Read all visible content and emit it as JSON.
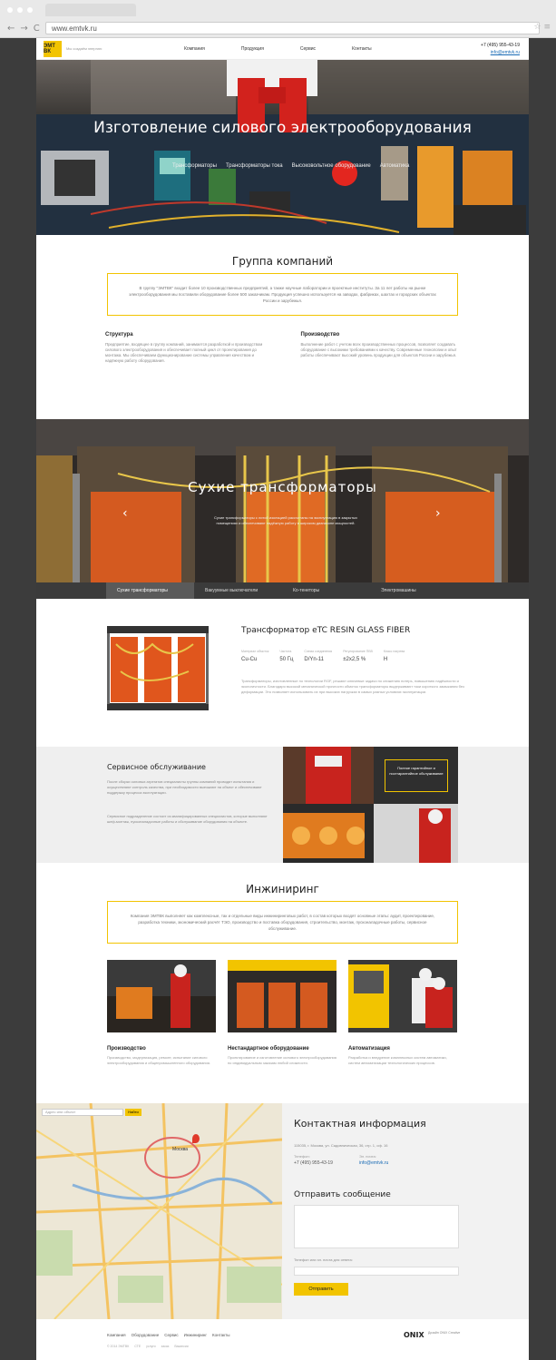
{
  "browser": {
    "url": "www.emtvk.ru",
    "back": "←",
    "forward": "→",
    "reload": "C",
    "star": "☆ ≡"
  },
  "header": {
    "logo": "ЭМТ ВК",
    "tagline": "Мы создаём энергию",
    "nav": [
      "Компания",
      "Продукция",
      "Сервис",
      "Контакты"
    ],
    "phone": "+7 (495) 955-43-19",
    "email": "info@emtvk.ru"
  },
  "hero": {
    "title": "Изготовление силового электрооборудования",
    "links": [
      "Трансформаторы",
      "Трансформаторы тока",
      "Высоковольтное оборудование",
      "Автоматика"
    ]
  },
  "group": {
    "title": "Группа компаний",
    "intro": "В группу \"ЭМТВК\" входит более 10 производственных предприятий, а также научные лаборатории и проектные институты. За 11 лет работы на рынке электрооборудования мы поставили оборудование более 500 заказчикам. Продукция успешно используется на заводах, фабриках, шахтах и городских объектах России и зарубежья.",
    "cols": [
      {
        "title": "Структура",
        "text": "Предприятие, входящее в группу компаний, занимается разработкой и производством силового электрооборудования и обеспечивает полный цикл от проектирования до монтажа. Мы обеспечиваем функционирование системы управления качеством и надёжную работу оборудования."
      },
      {
        "title": "Производство",
        "text": "Выполнение работ с учетом всех производственных процессов, позволяет создавать оборудование с высокими требованиями к качеству. Современные технологии и опыт работы обеспечивают высокий уровень продукции для объектов России и зарубежья."
      }
    ]
  },
  "transformers": {
    "title": "Сухие трансформаторы",
    "desc": "Сухие трансформаторы с литой изоляцией рассчитаны на эксплуатацию в закрытых помещениях и обеспечивают надёжную работу в широком диапазоне мощностей.",
    "prev": "‹",
    "next": "›",
    "tabs": [
      "Сухие трансформаторы",
      "Вакуумные выключатели",
      "Ко-тенеторы",
      "Электромашины"
    ]
  },
  "product": {
    "title": "Трансформатор eTC RESIN GLASS FIBER",
    "specs": [
      {
        "k": "Материал обмоток",
        "v": "Cu-Cu"
      },
      {
        "k": "Частота",
        "v": "50 Гц"
      },
      {
        "k": "Схема соединения",
        "v": "D/Yn-11"
      },
      {
        "k": "Регулирование ПБВ",
        "v": "±2х2,5 %"
      },
      {
        "k": "Класс нагрева",
        "v": "H"
      }
    ],
    "desc": "Трансформаторы, изготовленные по технологии RGF, решают ключевые задачи по снижению потерь, повышению надёжности и экологичности. Благодаря высокой механической прочности обмоток трансформаторы выдерживают токи короткого замыкания без деформации. Это позволяет использовать их при высоких нагрузках в самых разных условиях эксплуатации."
  },
  "service": {
    "title": "Сервисное обслуживание",
    "p1": "После сборки силовых агрегатов специалисты группы компаний проводят испытания и осуществляют контроль качества, при необходимости выезжают на объект и обеспечивают поддержку процесса эксплуатации.",
    "p2": "Сервисное подразделение состоит из квалифицированных специалистов, которые выполняют шеф-монтаж, пусконаладочные работы и обслуживание оборудования на объекте.",
    "box": "Полное гарантийное и постгарантийное обслуживание"
  },
  "engineering": {
    "title": "Инжиниринг",
    "intro": "Компания ЭМТВК выполняет как комплексные, так и отдельные виды инжиниринговых работ, в состав которых входят основные этапы: аудит, проектирование, разработка техники, экономический расчёт ТЭО, производство и поставка оборудования, строительство, монтаж, пусконаладочные работы, сервисное обслуживание.",
    "cards": [
      {
        "title": "Производство",
        "text": "Производство, модернизация, ремонт, испытание силового электрооборудования и общепромышленного оборудования."
      },
      {
        "title": "Нестандартное оборудование",
        "text": "Проектирование и изготовление силового электрооборудования по индивидуальным заказам любой сложности."
      },
      {
        "title": "Автоматизация",
        "text": "Разработка и внедрение комплексных систем автоматики, систем автоматизации технологических процессов."
      }
    ]
  },
  "contact": {
    "title": "Контактная информация",
    "address": "115035, г. Москва, ул. Садовническая, 36, стр. 1, оф. 16",
    "phone_label": "Телефон:",
    "phone": "+7 (495) 955-43-19",
    "email_label": "Эл. почта:",
    "email": "info@emtvk.ru",
    "form_title": "Отправить сообщение",
    "form_label": "Телефон или эл. почта для ответа:",
    "send": "Отправить",
    "map_city": "Москва",
    "map_search": "Найти",
    "map_search_placeholder": "Адрес или объект"
  },
  "footer": {
    "nav": [
      "Компания",
      "Оборудование",
      "Сервис",
      "Инжиниринг",
      "Контакты"
    ],
    "sub": [
      "© 2014 ЭМТВК",
      "СТЕ",
      "услуги",
      "заказ",
      "Вакансии"
    ],
    "brand": "ONIX",
    "brand_sub": "Дизайн ONIX Creative"
  }
}
